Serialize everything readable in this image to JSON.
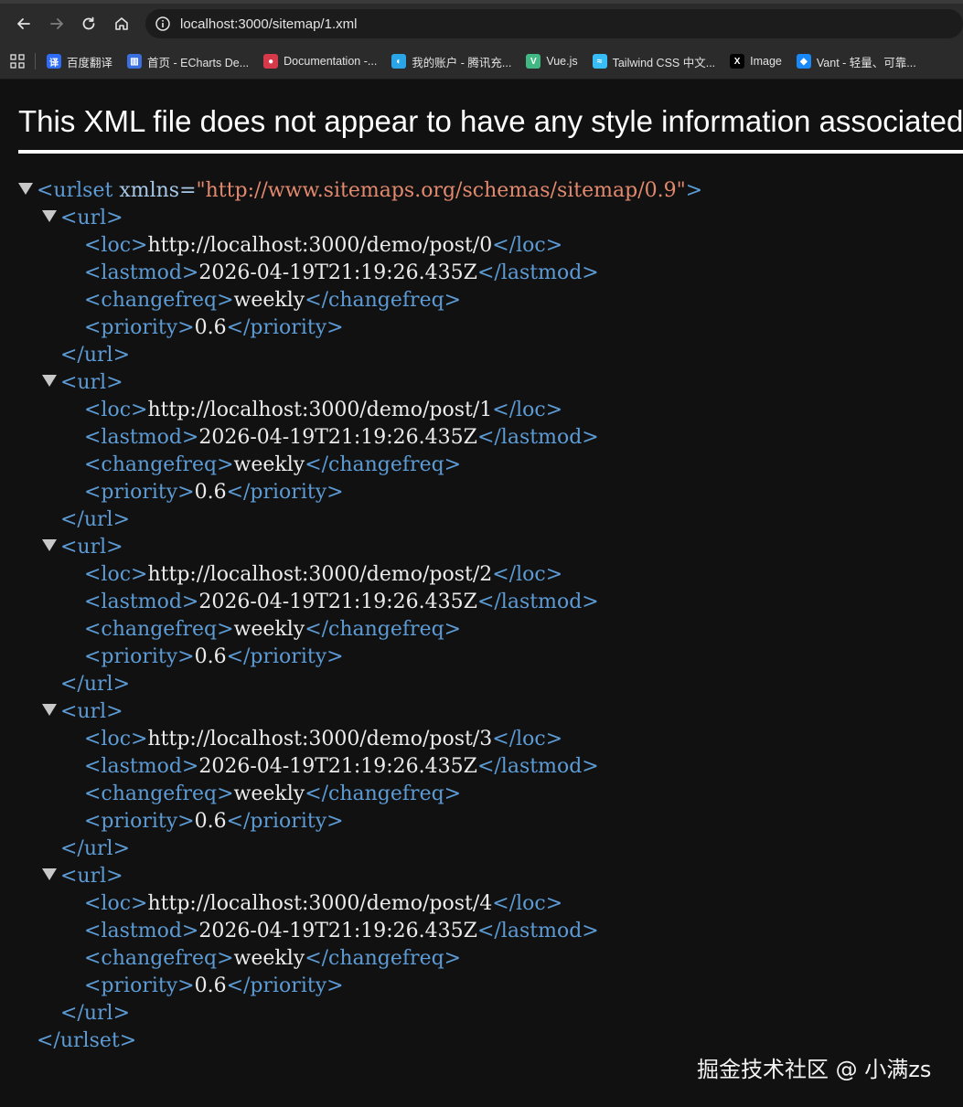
{
  "browser": {
    "url": "localhost:3000/sitemap/1.xml",
    "bookmarks": [
      {
        "label": "百度翻译",
        "icon": "baidu-translate-icon",
        "color": "#2f6df6",
        "glyph": "译"
      },
      {
        "label": "首页 - ECharts De...",
        "icon": "echarts-icon",
        "color": "#3b6fe0",
        "glyph": "▥"
      },
      {
        "label": "Documentation -...",
        "icon": "documentation-icon",
        "color": "#d63a4a",
        "glyph": "●"
      },
      {
        "label": "我的账户 - 腾讯充...",
        "icon": "tencent-icon",
        "color": "#2aa5e8",
        "glyph": "◐"
      },
      {
        "label": "Vue.js",
        "icon": "vue-icon",
        "color": "#41b883",
        "glyph": "V"
      },
      {
        "label": "Tailwind CSS 中文...",
        "icon": "tailwind-icon",
        "color": "#38bdf8",
        "glyph": "≈"
      },
      {
        "label": "Image",
        "icon": "x-icon",
        "color": "#000000",
        "glyph": "X"
      },
      {
        "label": "Vant - 轻量、可靠...",
        "icon": "vant-icon",
        "color": "#1989fa",
        "glyph": "◆"
      }
    ]
  },
  "banner": "This XML file does not appear to have any style information associated with it. The document tree is shown below.",
  "xml": {
    "root_open": "<urlset",
    "root_attr_name": "xmlns=",
    "root_attr_value": "\"http://www.sitemaps.org/schemas/sitemap/0.9\"",
    "root_open_end": ">",
    "root_close": "</urlset>",
    "url_open": "<url>",
    "url_close": "</url>",
    "loc_open": "<loc>",
    "loc_close": "</loc>",
    "lastmod_open": "<lastmod>",
    "lastmod_close": "</lastmod>",
    "changefreq_open": "<changefreq>",
    "changefreq_close": "</changefreq>",
    "priority_open": "<priority>",
    "priority_close": "</priority>",
    "urls": [
      {
        "loc": "http://localhost:3000/demo/post/0",
        "lastmod": "2026-04-19T21:19:26.435Z",
        "changefreq": "weekly",
        "priority": "0.6"
      },
      {
        "loc": "http://localhost:3000/demo/post/1",
        "lastmod": "2026-04-19T21:19:26.435Z",
        "changefreq": "weekly",
        "priority": "0.6"
      },
      {
        "loc": "http://localhost:3000/demo/post/2",
        "lastmod": "2026-04-19T21:19:26.435Z",
        "changefreq": "weekly",
        "priority": "0.6"
      },
      {
        "loc": "http://localhost:3000/demo/post/3",
        "lastmod": "2026-04-19T21:19:26.435Z",
        "changefreq": "weekly",
        "priority": "0.6"
      },
      {
        "loc": "http://localhost:3000/demo/post/4",
        "lastmod": "2026-04-19T21:19:26.435Z",
        "changefreq": "weekly",
        "priority": "0.6"
      }
    ]
  },
  "watermark": "掘金技术社区 @ 小满zs"
}
